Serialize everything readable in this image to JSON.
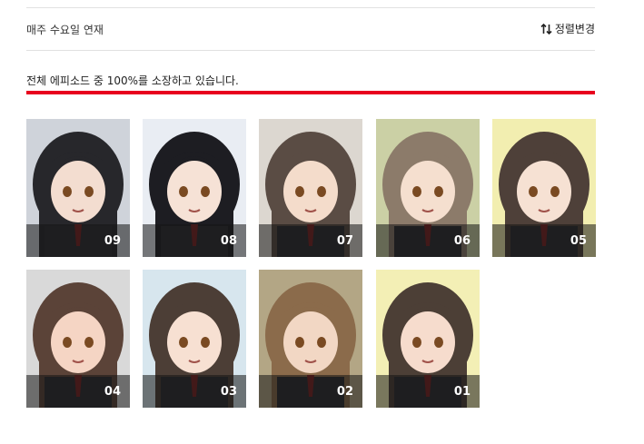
{
  "header": {
    "schedule": "매주 수요일 연재",
    "sort_label": "정렬변경",
    "sort_icon": "sort-arrows-icon"
  },
  "ownership": {
    "text": "전체 에피소드 중 100%를 소장하고 있습니다.",
    "percent": 100,
    "bar_color": "#e8001e"
  },
  "episodes": [
    {
      "number": "09",
      "bg": "#cfd3da",
      "hair": "#27272b",
      "skin": "#f3ddd0"
    },
    {
      "number": "08",
      "bg": "#e9edf3",
      "hair": "#1d1d22",
      "skin": "#f6e2d6"
    },
    {
      "number": "07",
      "bg": "#dcd7d0",
      "hair": "#5a4c44",
      "skin": "#f4dccb"
    },
    {
      "number": "06",
      "bg": "#cbd0a5",
      "hair": "#8c7b6a",
      "skin": "#f5dfcf"
    },
    {
      "number": "05",
      "bg": "#f2eeb0",
      "hair": "#4e4039",
      "skin": "#f6e1d3"
    },
    {
      "number": "04",
      "bg": "#d9d9d9",
      "hair": "#5b4338",
      "skin": "#f5d5c4"
    },
    {
      "number": "03",
      "bg": "#d7e6ee",
      "hair": "#4c3e36",
      "skin": "#f7e0d2"
    },
    {
      "number": "02",
      "bg": "#b3a685",
      "hair": "#8b6b4b",
      "skin": "#f2d7c4"
    },
    {
      "number": "01",
      "bg": "#f3efb5",
      "hair": "#4c3f36",
      "skin": "#f6dccd"
    }
  ]
}
